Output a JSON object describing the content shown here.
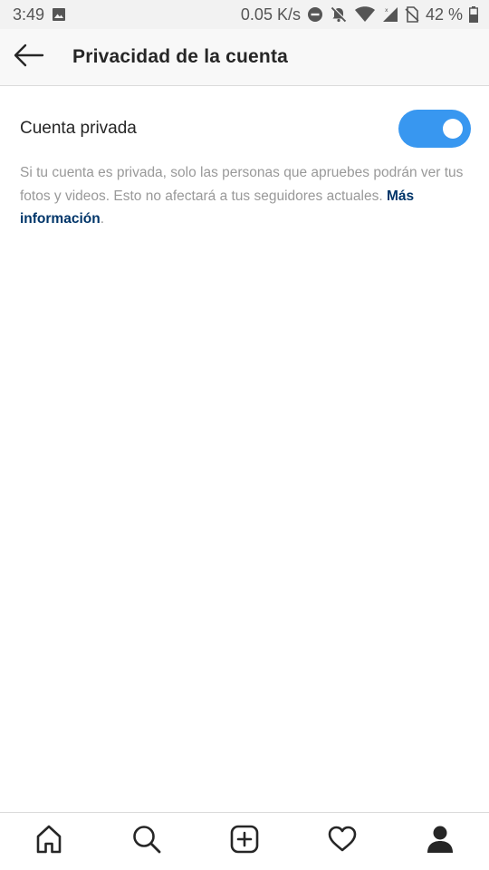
{
  "status_bar": {
    "time": "3:49",
    "network_speed": "0.05 K/s",
    "battery": "42 %",
    "icons": [
      "image-icon",
      "dnd-icon",
      "mute-icon",
      "wifi-icon",
      "signal-icon",
      "no-sim-icon",
      "battery-icon"
    ]
  },
  "header": {
    "back_icon": "arrow-left-icon",
    "title": "Privacidad de la cuenta"
  },
  "private_account": {
    "label": "Cuenta privada",
    "enabled": true,
    "accent_color": "#3897f0"
  },
  "description": {
    "text": "Si tu cuenta es privada, solo las personas que apruebes podrán ver tus fotos y videos. Esto no afectará a tus seguidores actuales. ",
    "link_text": "Más información",
    "suffix": "."
  },
  "bottom_nav": {
    "items": [
      "home-icon",
      "search-icon",
      "new-post-icon",
      "activity-heart-icon",
      "profile-icon"
    ]
  }
}
